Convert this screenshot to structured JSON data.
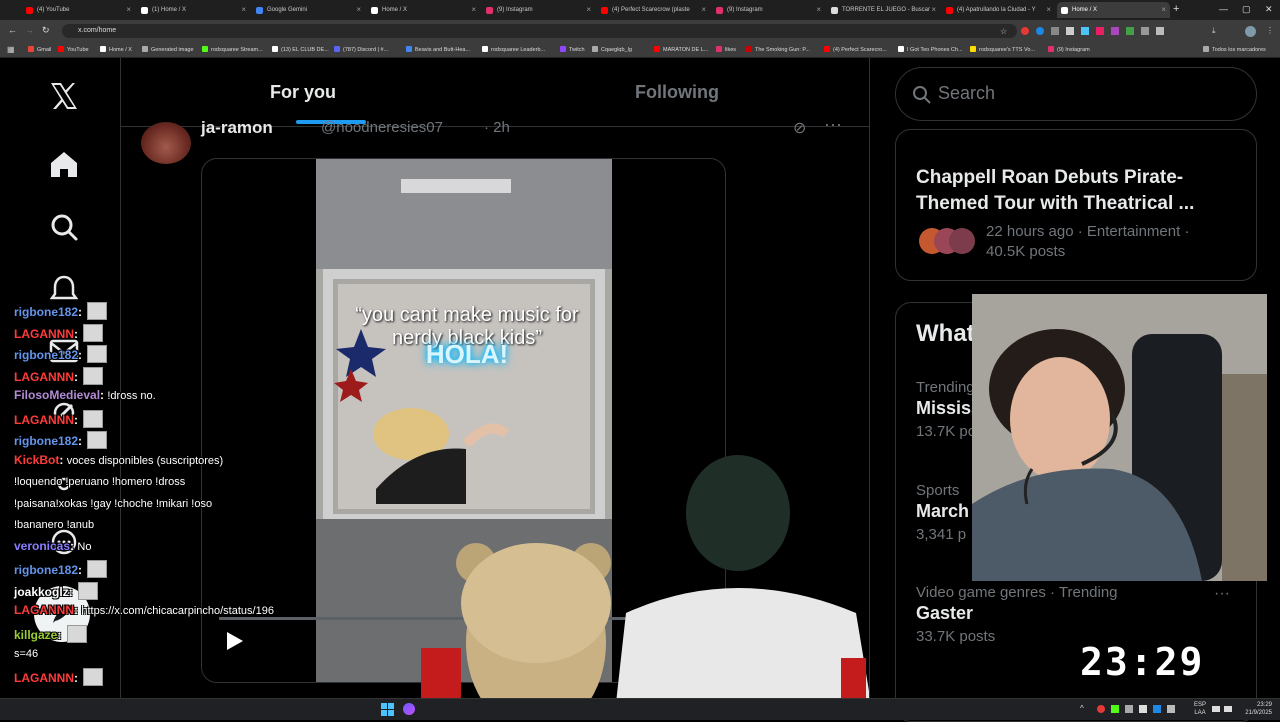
{
  "browser": {
    "tabs": [
      {
        "title": "(4) YouTube",
        "color": "#ff0000"
      },
      {
        "title": "(1) Home / X",
        "color": "#ffffff"
      },
      {
        "title": "Google Gemini",
        "color": "#4285f4"
      },
      {
        "title": "Home / X",
        "color": "#ffffff"
      },
      {
        "title": "(9) Instagram",
        "color": "#e1306c"
      },
      {
        "title": "(4) Perfect Scarecrow (plaste",
        "color": "#ff0000"
      },
      {
        "title": "(9) Instagram",
        "color": "#e1306c"
      },
      {
        "title": "TORRENTE EL JUEGO - Buscar",
        "color": "#dddddd"
      },
      {
        "title": "(4) Apatrullando la Ciudad - Y",
        "color": "#ff0000"
      },
      {
        "title": "Home / X",
        "color": "#ffffff"
      }
    ],
    "new_tab": "+",
    "url": "x.com/home",
    "bookmarks": [
      {
        "label": "Gmail",
        "color": "#ea4335"
      },
      {
        "label": "YouTube",
        "color": "#ff0000"
      },
      {
        "label": "Home / X",
        "color": "#ffffff"
      },
      {
        "label": "Generated image",
        "color": "#aaaaaa"
      },
      {
        "label": "rodsquaree Stream...",
        "color": "#53fc18"
      },
      {
        "label": "(13) EL CLUB DE...",
        "color": "#ffffff"
      },
      {
        "label": "(787) Discord | #...",
        "color": "#5865f2"
      },
      {
        "label": "Beavis and Butt-Hea...",
        "color": "#4285f4"
      },
      {
        "label": "rodsquaree Leaderb...",
        "color": "#ffffff"
      },
      {
        "label": "Twitch",
        "color": "#9146ff"
      },
      {
        "label": "Cqaeglqb_lg",
        "color": "#aaaaaa"
      },
      {
        "label": "MARATON DE L...",
        "color": "#ff0000"
      },
      {
        "label": "likes",
        "color": "#e1306c"
      },
      {
        "label": "The Smoking Gun: P...",
        "color": "#cc0000"
      },
      {
        "label": "(4) Perfect Scarecro...",
        "color": "#ff0000"
      },
      {
        "label": "I Got Teo Phones Ch...",
        "color": "#ffffff"
      },
      {
        "label": "rodsquaree's TTS Vo...",
        "color": "#ffdd00"
      },
      {
        "label": "(9) Instagram",
        "color": "#e1306c"
      },
      {
        "label": "Todos los marcadores",
        "color": "#aaaaaa"
      }
    ]
  },
  "x": {
    "tabs": [
      {
        "label": "For you",
        "selected": true
      },
      {
        "label": "Following",
        "selected": false
      }
    ],
    "post": {
      "author": "ja-ramon",
      "handle": "@noodneresies07",
      "time": "· 2h",
      "caption": "“you cant make music for nerdy black kids”",
      "overlay": "HOLA!"
    },
    "search_placeholder": "Search",
    "trend_card": {
      "headline": "Chappell Roan Debuts Pirate-Themed Tour with Theatrical ...",
      "meta": "22 hours ago · Entertainment · 40.5K posts"
    },
    "whats_happening": {
      "title": "What",
      "items": [
        {
          "context": "Trending",
          "name": "Mississi",
          "posts": "13.7K post"
        },
        {
          "context": "Sports",
          "name": "March",
          "posts": "3,341 p"
        },
        {
          "context": "Video game genres · Trending",
          "name": "Gaster",
          "posts": "33.7K posts"
        }
      ]
    }
  },
  "stream": {
    "chat": [
      {
        "user": "rigbone182",
        "color": "#6495ed",
        "msg": "",
        "emote": true
      },
      {
        "user": "LAGANNN",
        "color": "#ff3b3b",
        "msg": "",
        "emote": true
      },
      {
        "user": "rigbone182",
        "color": "#6495ed",
        "msg": "",
        "emote": true
      },
      {
        "user": "LAGANNN",
        "color": "#ff3b3b",
        "msg": "",
        "emote": true
      },
      {
        "user": "FilosoMedieval",
        "color": "#b38bd6",
        "msg": "!dross no.",
        "emote": false
      },
      {
        "user": "LAGANNN",
        "color": "#ff3b3b",
        "msg": "",
        "emote": true
      },
      {
        "user": "rigbone182",
        "color": "#6495ed",
        "msg": "",
        "emote": true
      },
      {
        "user": "KickBot",
        "color": "#ff3b3b",
        "msg": "voces disponibles (suscriptores)",
        "emote": false
      },
      {
        "user": "",
        "color": "#ffffff",
        "msg": "!loquendo !peruano !homero !dross",
        "emote": false
      },
      {
        "user": "",
        "color": "#ffffff",
        "msg": "!paisana!xokas !gay !choche !mikari !oso",
        "emote": false
      },
      {
        "user": "",
        "color": "#ffffff",
        "msg": "!bananero !anub",
        "emote": false
      },
      {
        "user": "veronicas",
        "color": "#8a7dff",
        "msg": "No",
        "emote": false
      },
      {
        "user": "rigbone182",
        "color": "#6495ed",
        "msg": "",
        "emote": true
      },
      {
        "user": "joakkoglz",
        "color": "#ffffff",
        "msg": "",
        "emote": true
      },
      {
        "user": "LAGANNN",
        "color": "#ff3b3b",
        "msg": "https://x.com/chicacarpincho/status/196",
        "emote": false
      },
      {
        "user": "killgaze",
        "color": "#9acd32",
        "msg": "",
        "emote": true
      },
      {
        "user": "",
        "color": "#ffffff",
        "msg": "s=46",
        "emote": false
      },
      {
        "user": "LAGANNN",
        "color": "#ff3b3b",
        "msg": "",
        "emote": true
      }
    ],
    "clock": "23:29"
  },
  "taskbar": {
    "lang": "ESP",
    "lang2": "LAA",
    "time": "23:29",
    "date": "21/9/2025"
  },
  "colors": {
    "accent": "#1d9bf0",
    "border": "#2f3336",
    "muted": "#71767b"
  }
}
